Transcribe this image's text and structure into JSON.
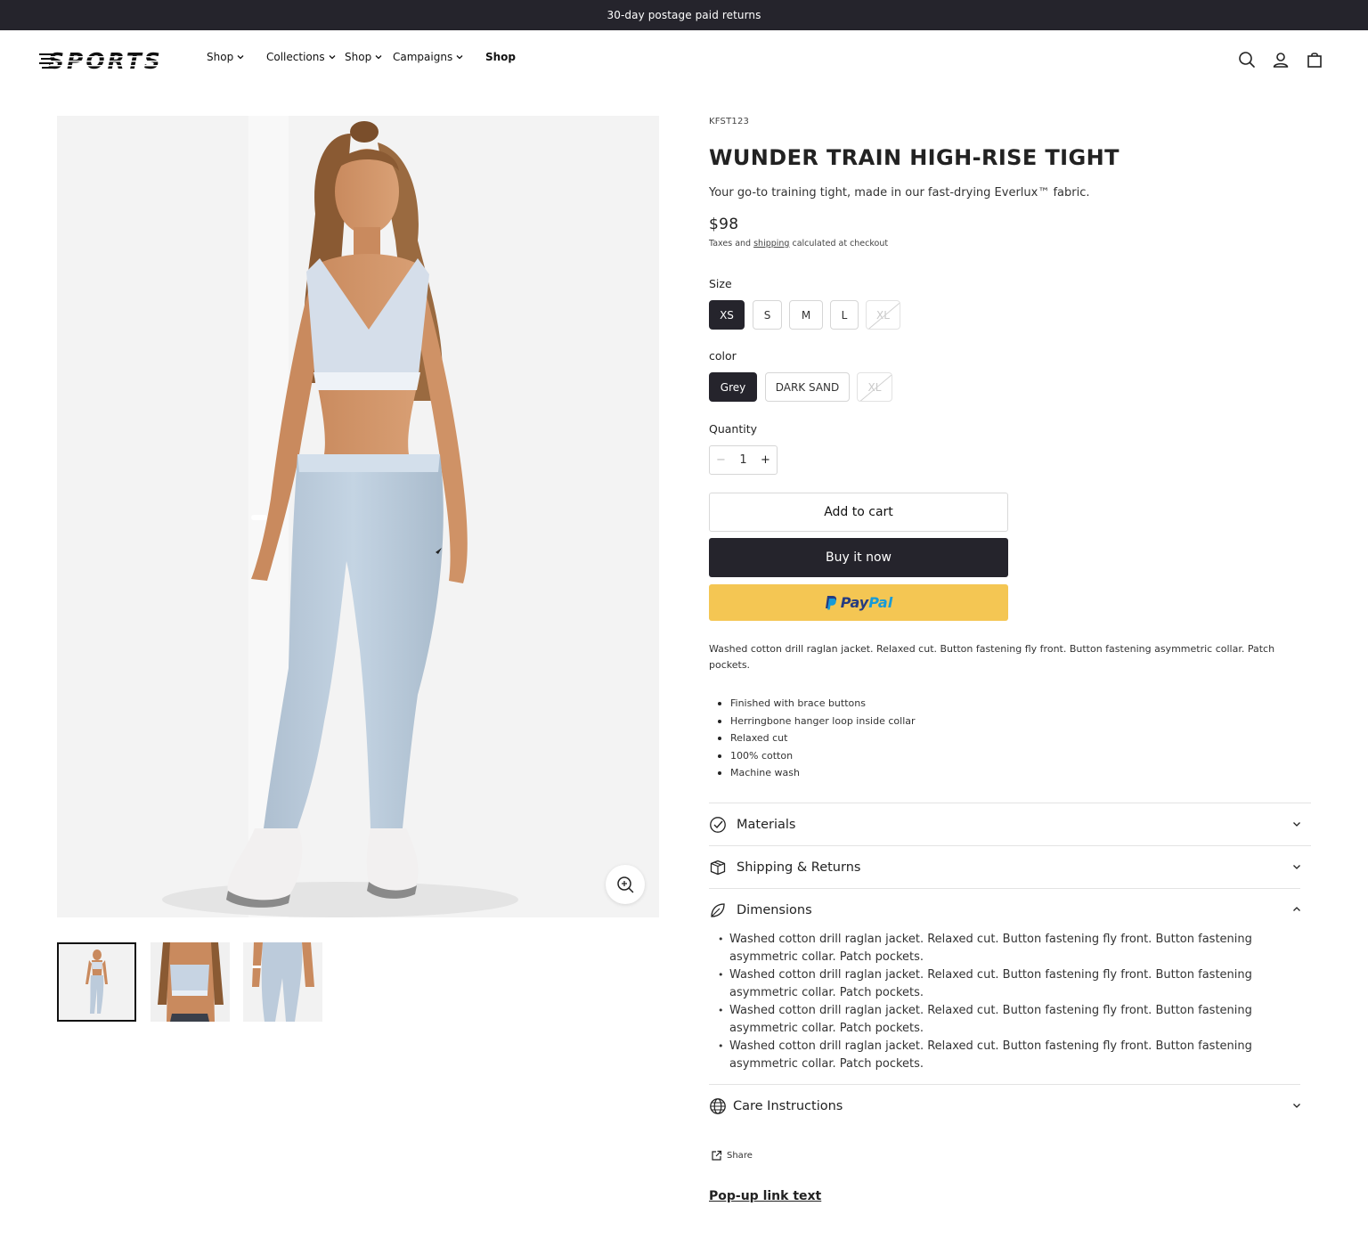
{
  "announcement": "30-day postage paid returns",
  "brand": {
    "logo_text": "SPORTS"
  },
  "nav": {
    "items": [
      {
        "label": "Shop",
        "has_dropdown": true
      },
      {
        "label": "Collections",
        "has_dropdown": true
      },
      {
        "label": "Shop",
        "has_dropdown": true
      },
      {
        "label": "Campaigns",
        "has_dropdown": true
      },
      {
        "label": "Shop",
        "has_dropdown": false
      }
    ],
    "icons": [
      "search-icon",
      "account-icon",
      "cart-icon"
    ]
  },
  "product": {
    "sku": "KFST123",
    "title": "WUNDER TRAIN HIGH-RISE TIGHT",
    "tagline": "Your go-to training tight, made in our fast-drying Everlux™ fabric.",
    "price": "$98",
    "taxes_prefix": "Taxes and ",
    "taxes_link": "shipping",
    "taxes_suffix": " calculated at checkout"
  },
  "size": {
    "label": "Size",
    "options": [
      {
        "label": "XS",
        "state": "selected"
      },
      {
        "label": "S",
        "state": "available"
      },
      {
        "label": "M",
        "state": "available"
      },
      {
        "label": "L",
        "state": "available"
      },
      {
        "label": "XL",
        "state": "unavailable"
      }
    ]
  },
  "color": {
    "label": "color",
    "options": [
      {
        "label": "Grey",
        "state": "selected"
      },
      {
        "label": "DARK SAND",
        "state": "available"
      },
      {
        "label": "XL",
        "state": "unavailable"
      }
    ]
  },
  "quantity": {
    "label": "Quantity",
    "value": "1",
    "minus": "−",
    "plus": "+"
  },
  "buttons": {
    "add_to_cart": "Add to cart",
    "buy_now": "Buy it now",
    "paypal_pay": "Pay",
    "paypal_pal": "Pal"
  },
  "description": "Washed cotton drill raglan jacket. Relaxed cut. Button fastening fly front. Button fastening asymmetric collar. Patch pockets.",
  "features": [
    "Finished with brace buttons",
    "Herringbone hanger loop inside collar",
    "Relaxed cut",
    "100% cotton",
    "Machine wash"
  ],
  "accordions": [
    {
      "title": "Materials",
      "icon": "check-circle-icon",
      "expanded": false
    },
    {
      "title": "Shipping & Returns",
      "icon": "box-icon",
      "expanded": false
    },
    {
      "title": "Dimensions",
      "icon": "leaf-icon",
      "expanded": true
    },
    {
      "title": "Care Instructions",
      "icon": "globe-icon",
      "expanded": false
    }
  ],
  "dimensions_items": [
    "Washed cotton drill raglan jacket. Relaxed cut. Button fastening fly front. Button fastening asymmetric collar. Patch pockets.",
    "Washed cotton drill raglan jacket. Relaxed cut. Button fastening fly front. Button fastening asymmetric collar. Patch pockets.",
    "Washed cotton drill raglan jacket. Relaxed cut. Button fastening fly front. Button fastening asymmetric collar. Patch pockets.",
    "Washed cotton drill raglan jacket. Relaxed cut. Button fastening fly front. Button fastening asymmetric collar. Patch pockets."
  ],
  "share_label": "Share",
  "popup_link": "Pop-up link text",
  "colors": {
    "dark": "#25242c",
    "paypal_yellow": "#f4c653",
    "paypal_blue_dark": "#253b80",
    "paypal_blue_light": "#179bd7",
    "garment": "#bfd0e0"
  }
}
